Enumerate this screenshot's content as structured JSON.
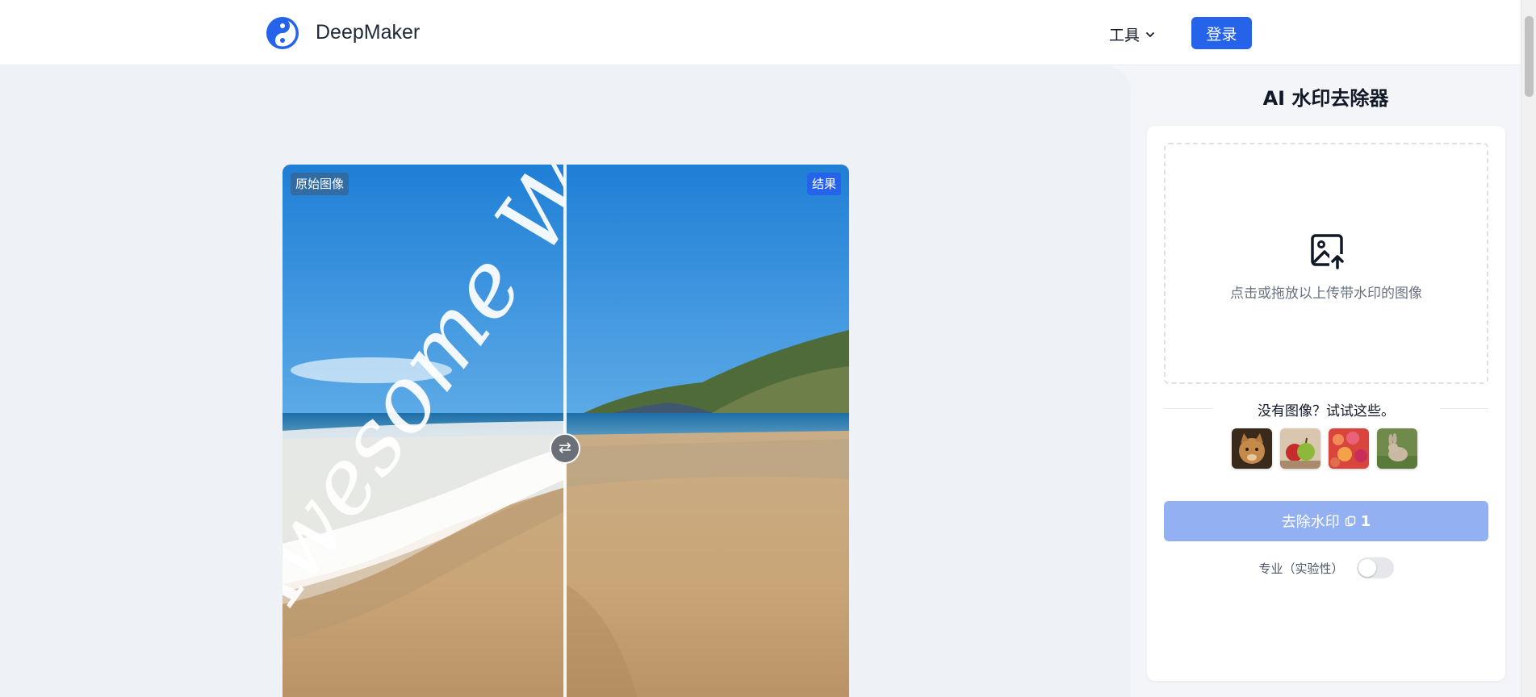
{
  "header": {
    "brand": "DeepMaker",
    "tools_menu": "工具",
    "login_button": "登录"
  },
  "editor": {
    "original_badge": "原始图像",
    "result_badge": "结果",
    "watermark_text": "Awesome W",
    "swap_glyph": "⇄"
  },
  "panel": {
    "title": "AI 水印去除器",
    "dropzone_text": "点击或拖放以上传带水印的图像",
    "samples_label": "没有图像？试试这些。",
    "samples": [
      "cat",
      "apple",
      "flowers",
      "rabbit"
    ],
    "remove_button": "去除水印",
    "remove_cost": "1",
    "pro_label": "专业（实验性）",
    "pro_enabled": false
  },
  "colors": {
    "accent": "#2563eb",
    "accent_disabled": "#93b1f2"
  }
}
